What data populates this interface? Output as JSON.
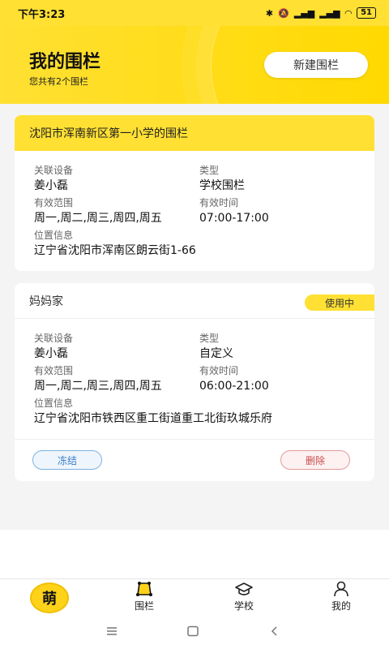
{
  "status_bar": {
    "time": "下午3:23",
    "battery": "51"
  },
  "header": {
    "title": "我的围栏",
    "subtitle": "您共有2个围栏",
    "new_fence_label": "新建围栏"
  },
  "labels": {
    "device": "关联设备",
    "type": "类型",
    "range": "有效范围",
    "time": "有效时间",
    "location": "位置信息"
  },
  "fences": [
    {
      "name": "沈阳市浑南新区第一小学的围栏",
      "device": "姜小磊",
      "type": "学校围栏",
      "range": "周一,周二,周三,周四,周五",
      "time": "07:00-17:00",
      "location": "辽宁省沈阳市浑南区朗云街1-66"
    },
    {
      "name": "妈妈家",
      "status": "使用中",
      "device": "姜小磊",
      "type": "自定义",
      "range": "周一,周二,周三,周四,周五",
      "time": "06:00-21:00",
      "location": "辽宁省沈阳市铁西区重工街道重工北街玖城乐府",
      "freeze_label": "冻结",
      "delete_label": "删除"
    }
  ],
  "tab_bar": {
    "home_badge": "萌",
    "tabs": [
      "围栏",
      "学校",
      "我的"
    ]
  }
}
